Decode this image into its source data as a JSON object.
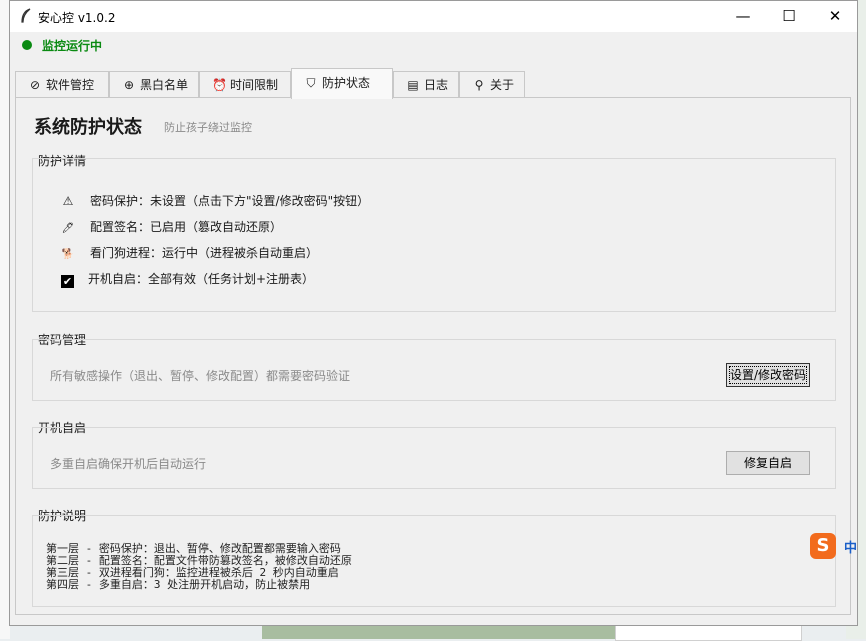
{
  "window": {
    "title": "安心控 v1.0.2",
    "icon": "feather-icon",
    "controls": {
      "minimize": "—",
      "maximize": "☐",
      "close": "✕"
    }
  },
  "status": {
    "text": "监控运行中",
    "color": "#0a8a12"
  },
  "tabs": [
    {
      "icon": "⊘",
      "icon_name": "block-icon",
      "label": "软件管控"
    },
    {
      "icon": "⊕",
      "icon_name": "globe-icon",
      "label": "黑白名单"
    },
    {
      "icon": "⏰",
      "icon_name": "alarm-clock-icon",
      "label": "时间限制"
    },
    {
      "icon": "⛉",
      "icon_name": "shield-icon",
      "label": "防护状态",
      "active": true
    },
    {
      "icon": "▤",
      "icon_name": "clipboard-icon",
      "label": "日志"
    },
    {
      "icon": "⚲",
      "icon_name": "pin-icon",
      "label": "关于"
    }
  ],
  "main": {
    "title": "系统防护状态",
    "subtitle": "防止孩子绕过监控"
  },
  "details": {
    "label": "防护详情",
    "items": [
      {
        "icon": "⚠",
        "icon_name": "warning-icon",
        "text": "密码保护：未设置（点击下方\"设置/修改密码\"按钮）"
      },
      {
        "icon": "🖊",
        "icon_name": "pen-icon",
        "text": "配置签名：已启用（篡改自动还原）"
      },
      {
        "icon": "🐕",
        "icon_name": "dog-icon",
        "text": "看门狗进程：运行中（进程被杀自动重启）"
      },
      {
        "icon": "✔",
        "icon_name": "checkbox-icon",
        "text": "开机自启：全部有效（任务计划+注册表）"
      }
    ]
  },
  "password": {
    "label": "密码管理",
    "description": "所有敏感操作（退出、暂停、修改配置）都需要密码验证",
    "button": "设置/修改密码"
  },
  "autostart": {
    "label": "开机自启",
    "description": "多重自启确保开机后自动运行",
    "button": "修复自启"
  },
  "explanation": {
    "label": "防护说明",
    "lines": [
      "第一层 - 密码保护：退出、暂停、修改配置都需要输入密码",
      "第二层 - 配置签名：配置文件带防篡改签名，被修改自动还原",
      "第三层 - 双进程看门狗：监控进程被杀后 2 秒内自动重启",
      "第四层 - 多重自启：3 处注册开机启动，防止被禁用"
    ]
  },
  "ime": {
    "logo": "S",
    "mode": "中"
  }
}
